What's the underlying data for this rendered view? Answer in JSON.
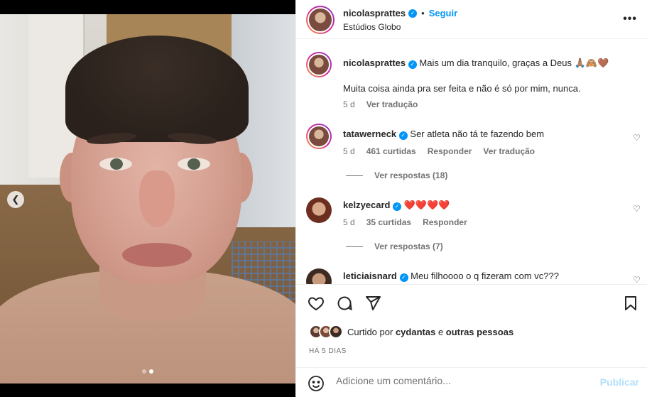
{
  "post": {
    "username": "nicolasprattes",
    "follow_label": "Seguir",
    "bullet": "•",
    "location": "Estúdios Globo",
    "more_label": "•••"
  },
  "caption": {
    "username": "nicolasprattes",
    "text_line1": "Mais um dia tranquilo, graças a Deus 🙏🏽🙈🤎",
    "text_line2": "Muita coisa ainda pra ser feita e não é só por mim, nunca.",
    "age": "5 d",
    "translate": "Ver tradução"
  },
  "comments": [
    {
      "username": "tatawerneck",
      "text": "Ser atleta não tá te fazendo bem",
      "age": "5 d",
      "likes": "461 curtidas",
      "reply": "Responder",
      "translate": "Ver tradução",
      "view_replies": "Ver respostas (18)"
    },
    {
      "username": "kelzyecard",
      "text": "❤️❤️❤️❤️",
      "age": "5 d",
      "likes": "35 curtidas",
      "reply": "Responder",
      "view_replies": "Ver respostas (7)"
    },
    {
      "username": "leticiaisnard",
      "text": "Meu filhoooo o q fizeram com vc???"
    }
  ],
  "likes_summary": {
    "prefix": "Curtido por",
    "user": "cydantas",
    "joiner": "e",
    "others": "outras pessoas"
  },
  "timestamp": "HÁ 5 DIAS",
  "composer": {
    "placeholder": "Adicione um comentário...",
    "publish_label": "Publicar"
  },
  "media": {
    "carousel_count": 2,
    "carousel_active_index": 1
  },
  "colors": {
    "accent": "#0095f6",
    "text": "#262626",
    "muted": "#737373",
    "publish_disabled": "#b2dffc"
  }
}
